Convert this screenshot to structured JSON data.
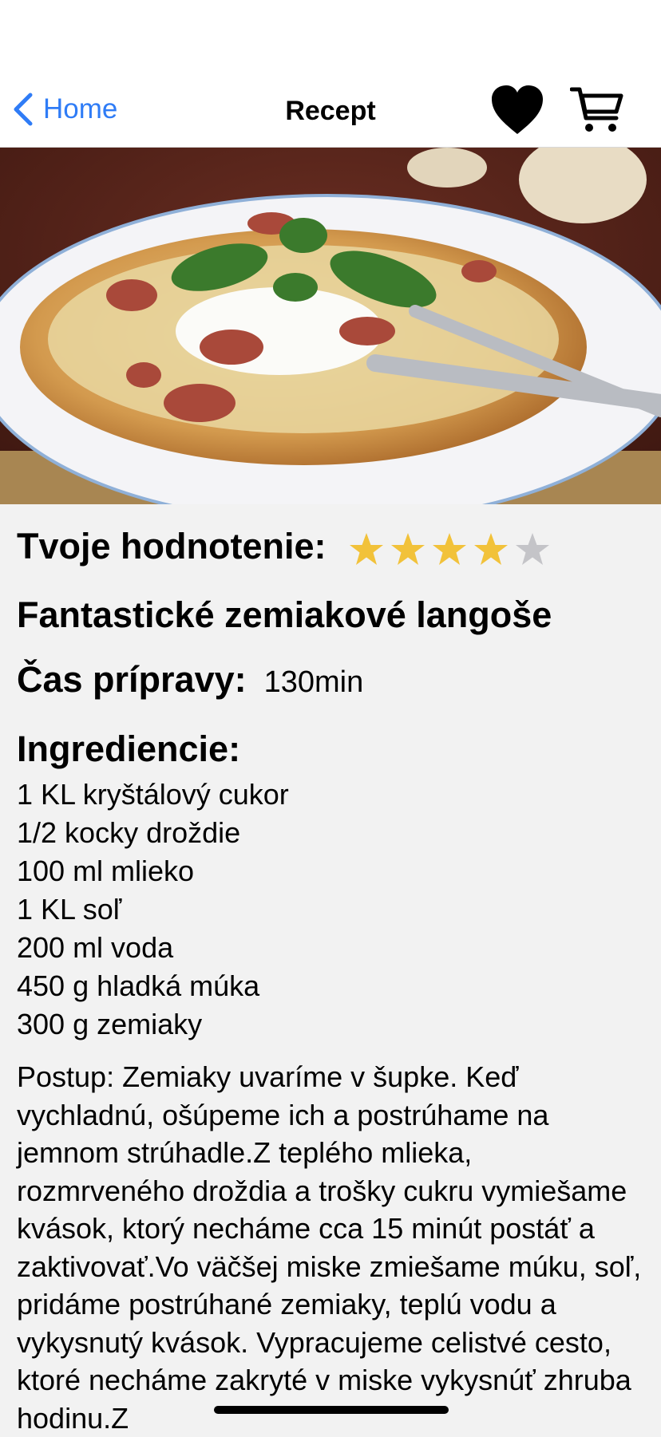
{
  "nav": {
    "back_label": "Home",
    "title": "Recept"
  },
  "rating": {
    "label": "Tvoje hodnotenie:",
    "value": 4,
    "max": 5,
    "filled_color": "#f2c23a",
    "empty_color": "#c4c4c8"
  },
  "recipe": {
    "title": "Fantastické zemiakové langoše",
    "time_label": "Čas prípravy:",
    "time_value": "130min",
    "ingredients_title": "Ingrediencie:",
    "ingredients": [
      "1 KL kryštálový cukor",
      "1/2 kocky droždie",
      "100 ml mlieko",
      "1 KL soľ",
      "200 ml voda",
      "450 g hladká múka",
      "300 g zemiaky"
    ],
    "steps": "Postup: Zemiaky uvaríme v šupke. Keď vychladnú, ošúpeme ich a postrúhame na jemnom strúhadle.Z teplého mlieka, rozmrveného droždia a trošky cukru vymiešame kvások, ktorý necháme cca 15 minút postáť a zaktivovať.Vo väčšej miske zmiešame múku, soľ, pridáme postrúhané zemiaky, teplú vodu a vykysnutý kvások. Vypracujeme celistvé cesto, ktoré necháme zakryté v miske vykysnúť zhruba hodinu.Z"
  },
  "colors": {
    "accent": "#2f7cf6"
  },
  "icons": {
    "back": "chevron-left-icon",
    "favorite": "heart-icon",
    "cart": "cart-icon"
  }
}
